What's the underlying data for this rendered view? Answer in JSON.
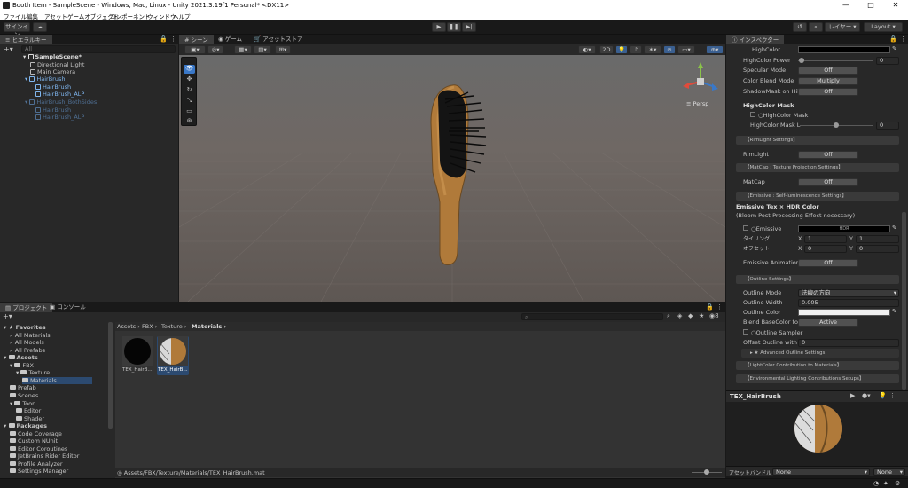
{
  "window": {
    "title": "Booth Item - SampleScene - Windows, Mac, Linux - Unity 2021.3.19f1 Personal* <DX11>",
    "minimize_label": "—",
    "maximize_label": "□",
    "close_label": "✕"
  },
  "menu": [
    "ファイル",
    "編集",
    "アセット",
    "ゲームオブジェクト",
    "コンポーネント",
    "ウィンドウ",
    "ヘルプ"
  ],
  "toolbar": {
    "signin": "サインイン",
    "layers": "レイヤー",
    "layout": "Layout"
  },
  "hierarchy": {
    "tab": "ヒエラルキー",
    "search_placeholder": "All",
    "items": [
      {
        "label": "SampleScene*",
        "style": "scene"
      },
      {
        "label": "Directional Light",
        "style": "normal"
      },
      {
        "label": "Main Camera",
        "style": "normal"
      },
      {
        "label": "HairBrush",
        "style": "blue"
      },
      {
        "label": "HairBrush",
        "style": "blue"
      },
      {
        "label": "HairBrush_ALP",
        "style": "blue"
      },
      {
        "label": "HairBrush_BothSides",
        "style": "dimblue"
      },
      {
        "label": "HairBrush",
        "style": "dimblue"
      },
      {
        "label": "HairBrush_ALP",
        "style": "dimblue"
      }
    ]
  },
  "scene_tabs": {
    "scene": "シーン",
    "game": "ゲーム",
    "asset_store": "アセットストア"
  },
  "scene_toolbar": {
    "mode_2d": "2D",
    "persp": "≡ Persp"
  },
  "inspector": {
    "tab": "インスペクター",
    "rows": {
      "highcolor": "HighColor",
      "highcolor_power": "HighColor Power",
      "highcolor_power_value": "0",
      "specular_mode": "Specular Mode",
      "specular_mode_value": "Off",
      "color_blend_mode": "Color Blend Mode",
      "color_blend_mode_value": "Multiply",
      "shadowmask": "ShadowMask on Hil",
      "shadowmask_value": "Off",
      "highcolor_mask_header": "HighColor Mask",
      "highcolor_mask": "HighColor Mask",
      "highcolor_mask_level": "HighColor Mask L",
      "highcolor_mask_level_value": "0",
      "rimlight_section": "【RimLight Settings】",
      "rimlight": "RimLight",
      "rimlight_value": "Off",
      "matcap_section": "【MatCap : Texture Projection Settings】",
      "matcap": "MatCap",
      "matcap_value": "Off",
      "emissive_section": "【Emissive : Self-luminescence Settings】",
      "emissive_header": "Emissive Tex × HDR Color",
      "emissive_sub": "(Bloom Post-Processing Effect necessary)",
      "emissive": "Emissive",
      "hdr_label": "HDR",
      "tiling": "タイリング",
      "offset": "オフセット",
      "tiling_x": "1",
      "tiling_y": "1",
      "offset_x": "0",
      "offset_y": "0",
      "emissive_anim": "Emissive Animation",
      "emissive_anim_value": "Off",
      "outline_section": "【Outline Settings】",
      "outline_mode": "Outline Mode",
      "outline_mode_value": "法線の方向",
      "outline_width": "Outline Width",
      "outline_width_value": "0.005",
      "outline_color": "Outline Color",
      "blend_basecolor": "Blend BaseColor to",
      "blend_basecolor_value": "Active",
      "outline_sampler": "Outline Sampler",
      "offset_outline": "Offset Outline with",
      "offset_outline_value": "0",
      "advanced_outline": "★ Advanced Outline Settings",
      "lightcolor_section": "【LightColor Contribution to Materials】",
      "env_section": "【Environmental Lighting Contributions Setups】"
    }
  },
  "preview": {
    "title": "TEX_HairBrush"
  },
  "assetbundle": {
    "label": "アセットバンドル",
    "value": "None",
    "variant": "None"
  },
  "project": {
    "tab": "プロジェクト",
    "console_tab": "コンソール",
    "breadcrumb": [
      "Assets",
      "FBX",
      "Texture",
      "Materials"
    ],
    "tree": [
      {
        "label": "Favorites",
        "indent": 0,
        "bold": true
      },
      {
        "label": "All Materials",
        "indent": 1
      },
      {
        "label": "All Models",
        "indent": 1
      },
      {
        "label": "All Prefabs",
        "indent": 1
      },
      {
        "label": "Assets",
        "indent": 0,
        "bold": true
      },
      {
        "label": "FBX",
        "indent": 1
      },
      {
        "label": "Texture",
        "indent": 2
      },
      {
        "label": "Materials",
        "indent": 3
      },
      {
        "label": "Prefab",
        "indent": 1
      },
      {
        "label": "Scenes",
        "indent": 1
      },
      {
        "label": "Toon",
        "indent": 1
      },
      {
        "label": "Editor",
        "indent": 2
      },
      {
        "label": "Shader",
        "indent": 2
      },
      {
        "label": "Packages",
        "indent": 0,
        "bold": true
      },
      {
        "label": "Code Coverage",
        "indent": 1
      },
      {
        "label": "Custom NUnit",
        "indent": 1
      },
      {
        "label": "Editor Coroutines",
        "indent": 1
      },
      {
        "label": "JetBrains Rider Editor",
        "indent": 1
      },
      {
        "label": "Profile Analyzer",
        "indent": 1
      },
      {
        "label": "Settings Manager",
        "indent": 1
      }
    ],
    "assets": [
      {
        "label": "TEX_HairB..."
      },
      {
        "label": "TEX_HairB..."
      }
    ],
    "path": "Assets/FBX/Texture/Materials/TEX_HairBrush.mat",
    "count_badge": "8"
  },
  "colors": {
    "accent": "#4a8ad6",
    "panel": "#282828",
    "bg": "#191919",
    "wood": "#b07a3a"
  }
}
